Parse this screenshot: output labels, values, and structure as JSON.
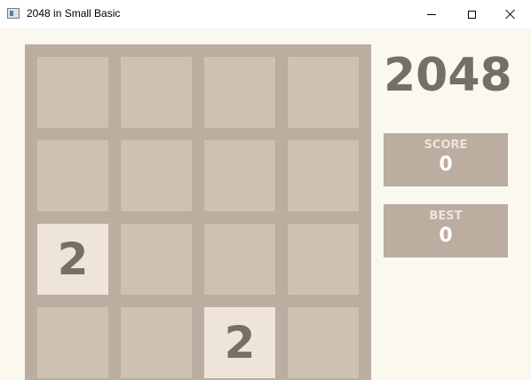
{
  "window": {
    "title": "2048 in Small Basic"
  },
  "colors": {
    "page_background": "#faf8ef",
    "board_background": "#bbada0",
    "empty_cell": "#cdc1b4",
    "tile_2": "#eee4da",
    "tile_text": "#776e65",
    "score_label": "#eee4da",
    "score_value": "#ffffff"
  },
  "game": {
    "title": "2048",
    "score_label": "SCORE",
    "score_value": "0",
    "best_label": "BEST",
    "best_value": "0",
    "board": [
      [
        "",
        "",
        "",
        ""
      ],
      [
        "",
        "",
        "",
        ""
      ],
      [
        "2",
        "",
        "",
        ""
      ],
      [
        "",
        "",
        "2",
        ""
      ]
    ]
  }
}
